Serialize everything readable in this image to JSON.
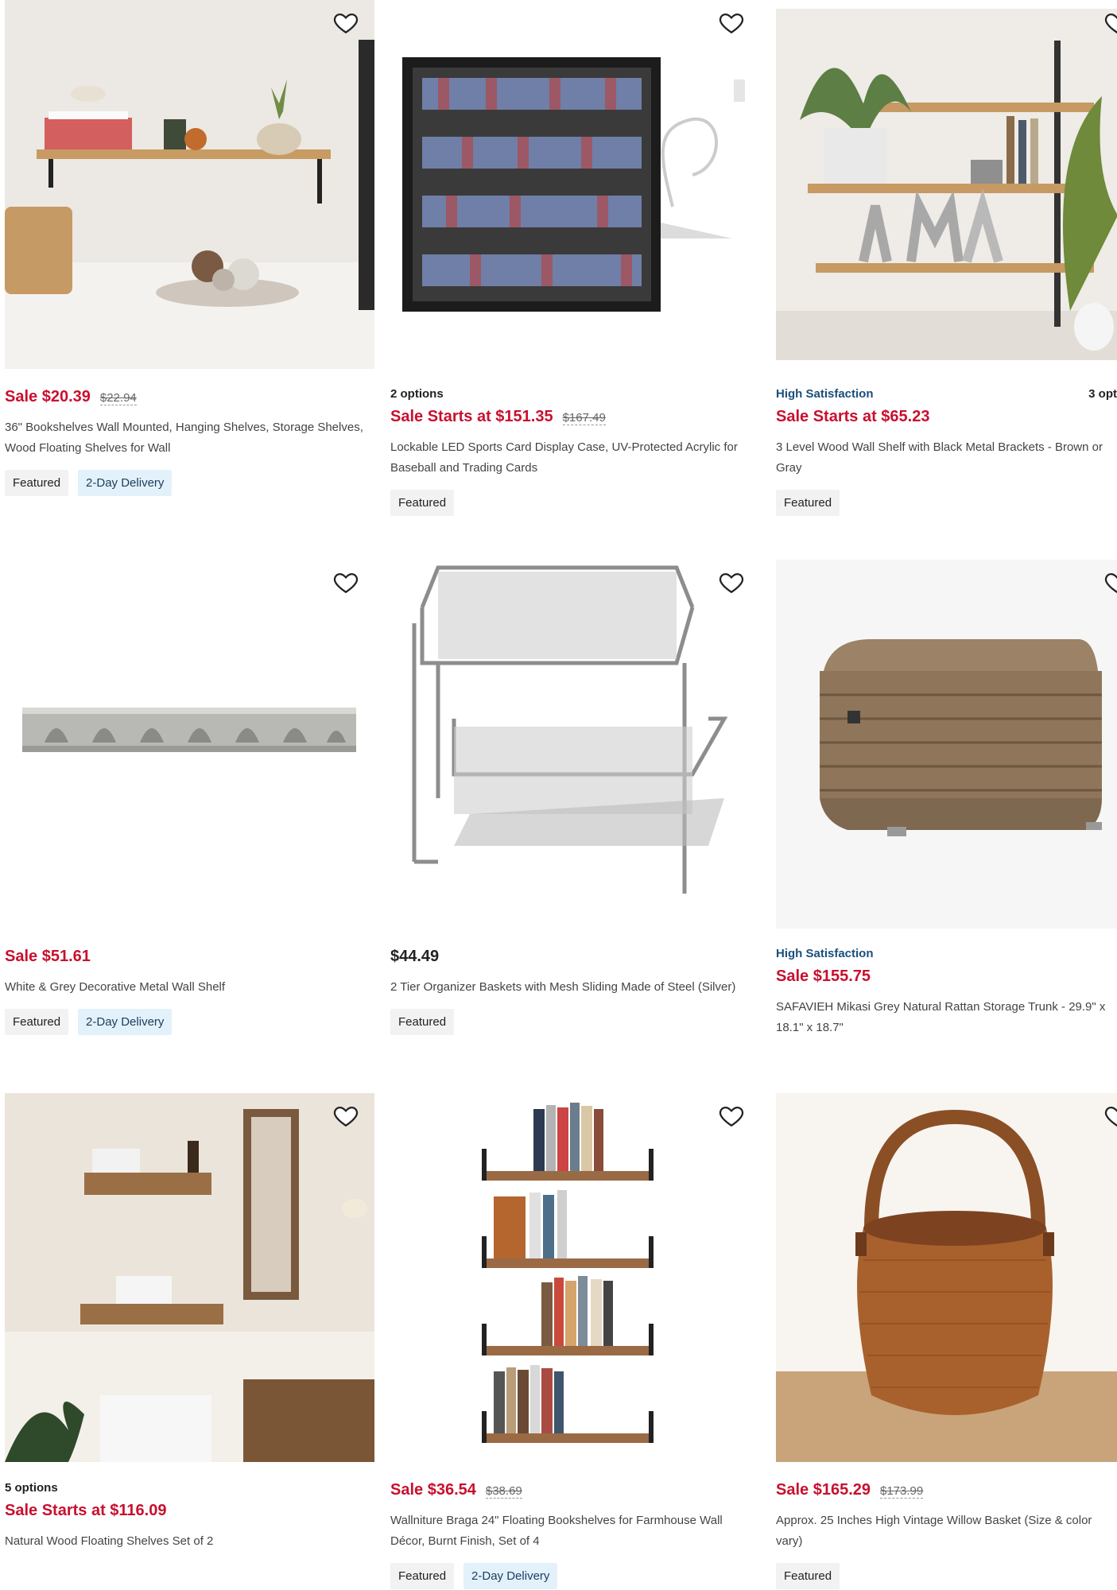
{
  "products": [
    {
      "meta_left": "",
      "meta_right": "",
      "price": "Sale $20.39",
      "was": "$22.94",
      "title": "36\" Bookshelves Wall Mounted, Hanging Shelves, Storage Shelves, Wood Floating Shelves for Wall",
      "badges": [
        "Featured",
        "2-Day Delivery"
      ]
    },
    {
      "meta_left": "2 options",
      "meta_right": "",
      "price": "Sale Starts at $151.35",
      "was": "$167.49",
      "title": "Lockable LED Sports Card Display Case, UV-Protected Acrylic for Baseball and Trading Cards",
      "badges": [
        "Featured"
      ]
    },
    {
      "meta_left": "High Satisfaction",
      "meta_right": "3 opt",
      "price": "Sale Starts at $65.23",
      "was": "",
      "title": "3 Level Wood Wall Shelf with Black Metal Brackets - Brown or Gray",
      "badges": [
        "Featured"
      ]
    },
    {
      "meta_left": "",
      "meta_right": "",
      "price": "Sale $51.61",
      "was": "",
      "title": "White & Grey Decorative Metal Wall Shelf",
      "badges": [
        "Featured",
        "2-Day Delivery"
      ]
    },
    {
      "meta_left": "",
      "meta_right": "",
      "price": "$44.49",
      "was": "",
      "title": "2 Tier Organizer Baskets with Mesh Sliding Made of Steel (Silver)",
      "badges": [
        "Featured"
      ]
    },
    {
      "meta_left": "High Satisfaction",
      "meta_right": "",
      "price": "Sale $155.75",
      "was": "",
      "title": "SAFAVIEH Mikasi Grey Natural Rattan Storage Trunk - 29.9\" x 18.1\" x 18.7\"",
      "badges": []
    },
    {
      "meta_left": "5 options",
      "meta_right": "",
      "price": "Sale Starts at $116.09",
      "was": "",
      "title": "Natural Wood Floating Shelves Set of 2",
      "badges": []
    },
    {
      "meta_left": "",
      "meta_right": "",
      "price": "Sale $36.54",
      "was": "$38.69",
      "title": "Wallniture Braga 24\" Floating Bookshelves for Farmhouse Wall Décor, Burnt Finish, Set of 4",
      "badges": [
        "Featured",
        "2-Day Delivery"
      ]
    },
    {
      "meta_left": "",
      "meta_right": "",
      "price": "Sale $165.29",
      "was": "$173.99",
      "title": "Approx. 25 Inches High Vintage Willow Basket (Size & color vary)",
      "badges": [
        "Featured"
      ]
    }
  ],
  "colors": {
    "sale": "#c8102e",
    "satisfaction": "#1a4f7a",
    "delivery_badge": "#e3f1fb",
    "featured_badge": "#f2f2f2"
  },
  "icons": {
    "wishlist": "heart-outline-icon"
  }
}
